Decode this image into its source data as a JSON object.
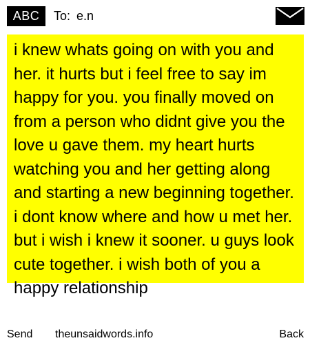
{
  "header": {
    "mode_badge": "ABC",
    "recipient_label": "To:",
    "recipient_value": "e.n",
    "mail_icon": "envelope-icon"
  },
  "message": {
    "text": "i knew whats going on with you and her. it hurts but i feel free to say im happy for you. you finally moved on from a person who didnt give you the love u gave them. my heart hurts watching you and her getting along and starting a new beginning together. i dont know where and how u met her. but i wish i knew it sooner. u guys look cute together. i wish both of you a happy relationship"
  },
  "softkeys": {
    "left": "Send",
    "center": "theunsaidwords.info",
    "right": "Back"
  },
  "colors": {
    "highlight": "#ffff00",
    "badge_background": "#000000",
    "badge_text": "#ffffff",
    "text": "#000000",
    "background": "#ffffff"
  }
}
